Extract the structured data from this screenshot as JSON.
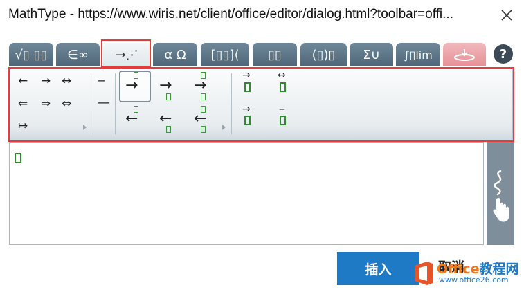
{
  "window": {
    "title": "MathType - https://www.wiris.net/client/office/editor/dialog.html?toolbar=offi...",
    "close_icon": "close-icon"
  },
  "tabs": [
    {
      "label": "√▯ ▯▯",
      "icon": "radical-fraction-icon"
    },
    {
      "label": "∈∞",
      "icon": "element-infinity-icon"
    },
    {
      "label": "→⋰",
      "icon": "arrow-dots-icon",
      "active": true
    },
    {
      "label": "α Ω",
      "icon": "greek-letters-icon"
    },
    {
      "label": "[▯▯]⟨",
      "icon": "matrix-bracket-icon"
    },
    {
      "label": "▯▯",
      "icon": "script-boxes-icon"
    },
    {
      "label": "(▯)▯",
      "icon": "parenthesis-hat-icon"
    },
    {
      "label": "Σ∪",
      "icon": "sum-union-icon"
    },
    {
      "label": "∫▯lim",
      "icon": "integral-limit-icon"
    },
    {
      "label": "",
      "icon": "contextual-icon"
    }
  ],
  "help": {
    "label": "?"
  },
  "toolbar": {
    "arrows": [
      [
        "←",
        "→",
        "↔"
      ],
      [
        "⇐",
        "⇒",
        "⇔"
      ],
      [
        "↦"
      ]
    ],
    "bars": [
      "‒",
      "—"
    ],
    "over_arrows": [
      "→",
      "→",
      "→"
    ],
    "under_arrows": [
      "←",
      "←",
      "←"
    ],
    "vector_arrows": [
      "→",
      "↔"
    ],
    "vector_bars": [
      "→",
      "‒"
    ]
  },
  "buttons": {
    "insert": "插入",
    "cancel": "取消"
  },
  "watermark": {
    "name_a": "Office",
    "name_b": "教程网",
    "url": "www.office26.com"
  },
  "colors": {
    "tab": "#5f778a",
    "accent": "#1f7ac6",
    "highlight": "#e23c3c",
    "placeholder": "#2e8b2e"
  }
}
